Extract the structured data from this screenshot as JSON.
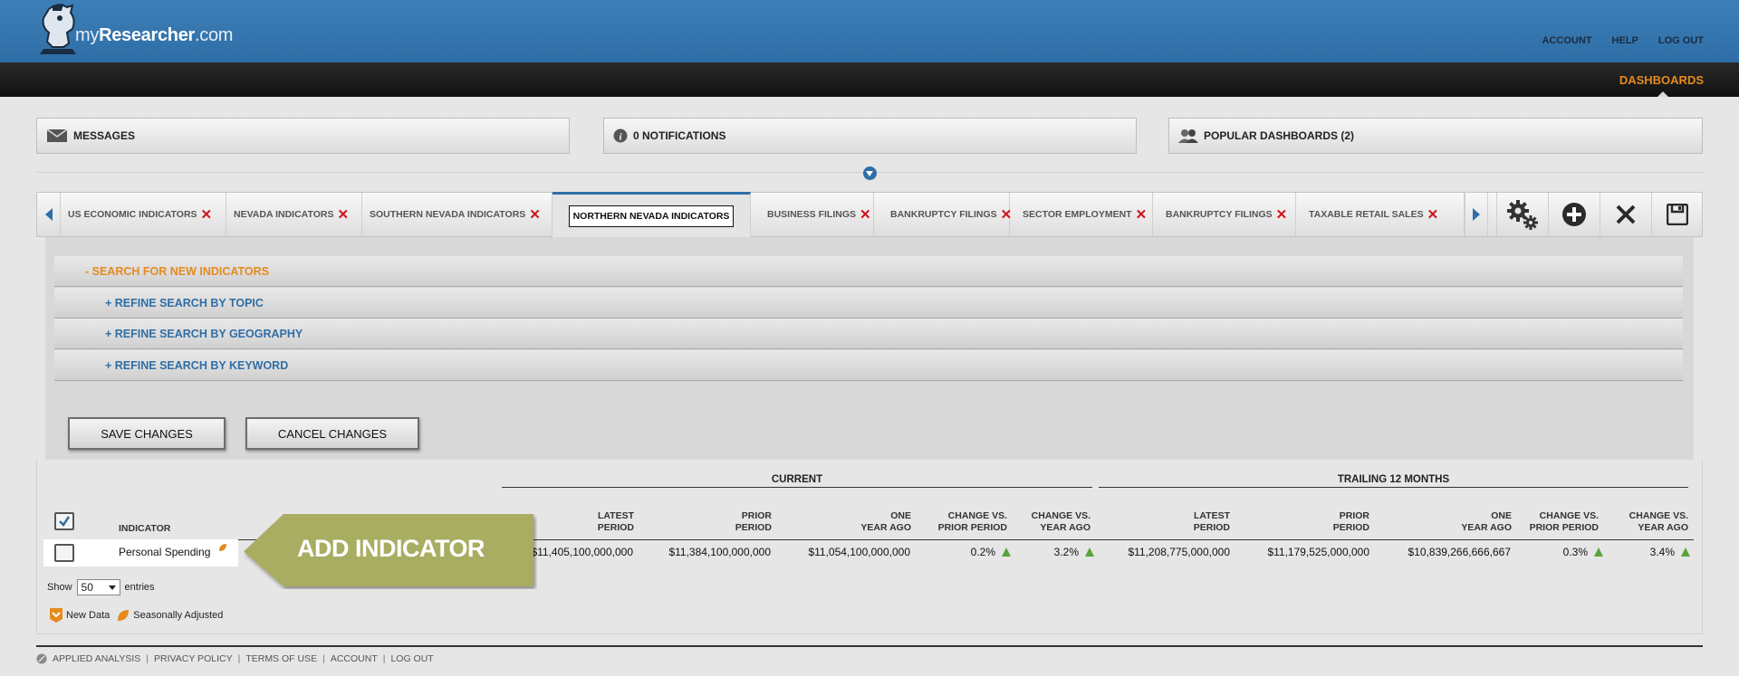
{
  "brand": {
    "prefix": "my",
    "name": "Researcher",
    "suffix": ".com"
  },
  "topnav": [
    "ACCOUNT",
    "HELP",
    "LOG OUT"
  ],
  "dashboards_link": "DASHBOARDS",
  "panels": {
    "messages": "MESSAGES",
    "notifications": "0 NOTIFICATIONS",
    "popular": "POPULAR DASHBOARDS (2)"
  },
  "tabs": [
    {
      "label": "US ECONOMIC INDICATORS"
    },
    {
      "label": "NEVADA INDICATORS"
    },
    {
      "label": "SOUTHERN NEVADA INDICATORS"
    },
    {
      "label": "NORTHERN NEVADA INDICATORS"
    },
    {
      "label": "BUSINESS FILINGS"
    },
    {
      "label": "BANKRUPTCY FILINGS"
    },
    {
      "label": "SECTOR EMPLOYMENT"
    },
    {
      "label": "BANKRUPTCY FILINGS"
    },
    {
      "label": "TAXABLE RETAIL SALES"
    }
  ],
  "search": {
    "main": "- SEARCH FOR NEW INDICATORS",
    "topic": "+ REFINE SEARCH BY TOPIC",
    "geography": "+ REFINE SEARCH BY GEOGRAPHY",
    "keyword": "+ REFINE SEARCH BY KEYWORD"
  },
  "buttons": {
    "save": "SAVE CHANGES",
    "cancel": "CANCEL CHANGES"
  },
  "table": {
    "groups": {
      "current": "CURRENT",
      "trailing": "TRAILING 12 MONTHS"
    },
    "indicator_header": "INDICATOR",
    "headers": {
      "latest": [
        "LATEST",
        "PERIOD"
      ],
      "prior": [
        "PRIOR",
        "PERIOD"
      ],
      "year": [
        "ONE",
        "YEAR AGO"
      ],
      "chg_prior": [
        "CHANGE VS.",
        "PRIOR PERIOD"
      ],
      "chg_year": [
        "CHANGE VS.",
        "YEAR AGO"
      ]
    },
    "row": {
      "indicator": "Personal Spending",
      "current": {
        "latest": "$11,405,100,000,000",
        "prior": "$11,384,100,000,000",
        "year": "$11,054,100,000,000",
        "chg_prior": "0.2%",
        "chg_year": "3.2%"
      },
      "trailing": {
        "latest": "$11,208,775,000,000",
        "prior": "$11,179,525,000,000",
        "year": "$10,839,266,666,667",
        "chg_prior": "0.3%",
        "chg_year": "3.4%"
      }
    }
  },
  "callout": "ADD INDICATOR",
  "show_entries": {
    "show": "Show",
    "value": "50",
    "entries": "entries"
  },
  "legend": {
    "new": "New Data",
    "seasonal": "Seasonally Adjusted"
  },
  "footer": [
    "APPLIED ANALYSIS",
    "PRIVACY POLICY",
    "TERMS OF USE",
    "ACCOUNT",
    "LOG OUT"
  ],
  "colors": {
    "header_blue": "#2f6ea6",
    "accent_orange": "#e58a1f",
    "delete_red": "#d0121b",
    "up_green": "#5aa43b",
    "callout_olive": "#a8ad62"
  }
}
